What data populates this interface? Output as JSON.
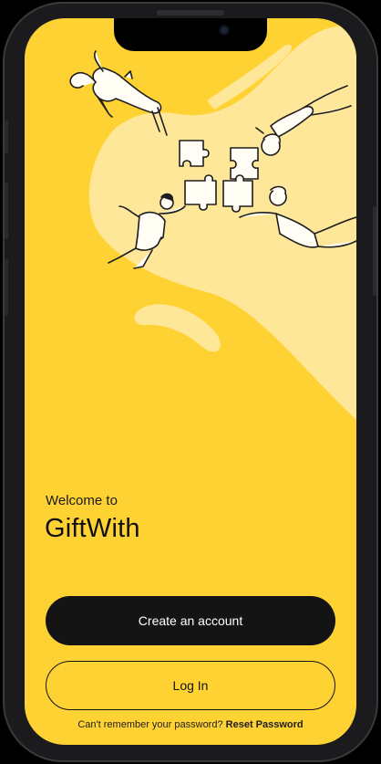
{
  "welcome": {
    "greeting": "Welcome to",
    "app_name": "GiftWith"
  },
  "actions": {
    "create_account_label": "Create an account",
    "login_label": "Log In"
  },
  "reset": {
    "prompt": "Can't remember your password?",
    "link_label": "Reset Password"
  },
  "illustration": {
    "description_icon": "puzzle-team-illustration"
  },
  "colors": {
    "screen_background": "#ffd233",
    "blob_light": "#ffe79a",
    "button_dark": "#141414",
    "button_text_light": "#ffffff"
  }
}
